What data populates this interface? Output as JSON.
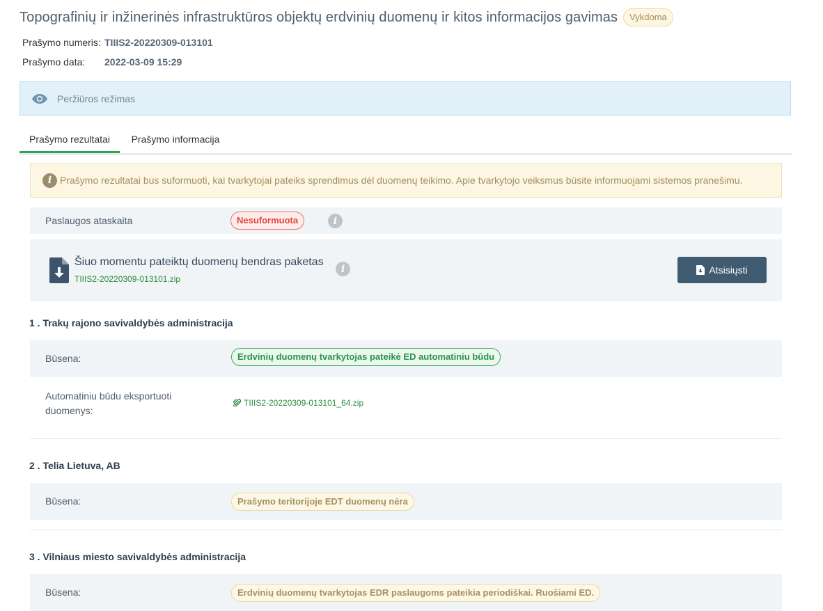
{
  "header": {
    "title": "Topografinių ir inžinerinės infrastruktūros objektų erdvinių duomenų ir kitos informacijos gavimas",
    "status": "Vykdoma",
    "request_number_label": "Prašymo numeris:",
    "request_number": "TIIIS2-20220309-013101",
    "request_date_label": "Prašymo data:",
    "request_date": "2022-03-09 15:29"
  },
  "view_mode": {
    "icon": "eye-icon",
    "label": "Peržiūros režimas"
  },
  "tabs": [
    {
      "label": "Prašymo rezultatai",
      "active": true
    },
    {
      "label": "Prašymo informacija",
      "active": false
    }
  ],
  "alert": {
    "icon": "info-icon",
    "text": "Prašymo rezultatai bus suformuoti, kai tvarkytojai pateiks sprendimus dėl duomenų teikimo. Apie tvarkytojo veiksmus būsite informuojami sistemos pranešimu."
  },
  "report": {
    "label": "Paslaugos ataskaita",
    "status": "Nesuformuota"
  },
  "package": {
    "title": "Šiuo momentu pateiktų duomenų bendras paketas",
    "file": "TIIIS2-20220309-013101.zip",
    "download_label": "Atsisiųsti"
  },
  "sections": [
    {
      "title": "1 . Trakų rajono savivaldybės administracija",
      "status_label": "Būsena:",
      "status": "Erdvinių duomenų tvarkytojas pateikė ED automatiniu būdu",
      "export_label_line1": "Automatiniu būdu eksportuoti",
      "export_label_line2": "duomenys:",
      "export_file": "TIIIS2-20220309-013101_64.zip"
    },
    {
      "title": "2 . Telia Lietuva, AB",
      "status_label": "Būsena:",
      "status": "Prašymo teritorijoje EDT duomenų nėra"
    },
    {
      "title": "3 . Vilniaus miesto savivaldybės administracija",
      "status_label": "Būsena:",
      "status": "Erdvinių duomenų tvarkytojas EDR paslaugoms pateikia periodiškai. Ruošiami ED."
    }
  ],
  "colors": {
    "accent_green": "#2fa254",
    "button_dark": "#405a70",
    "info_banner_bg": "#e1f0f9",
    "alert_bg": "#fdf6e3"
  }
}
